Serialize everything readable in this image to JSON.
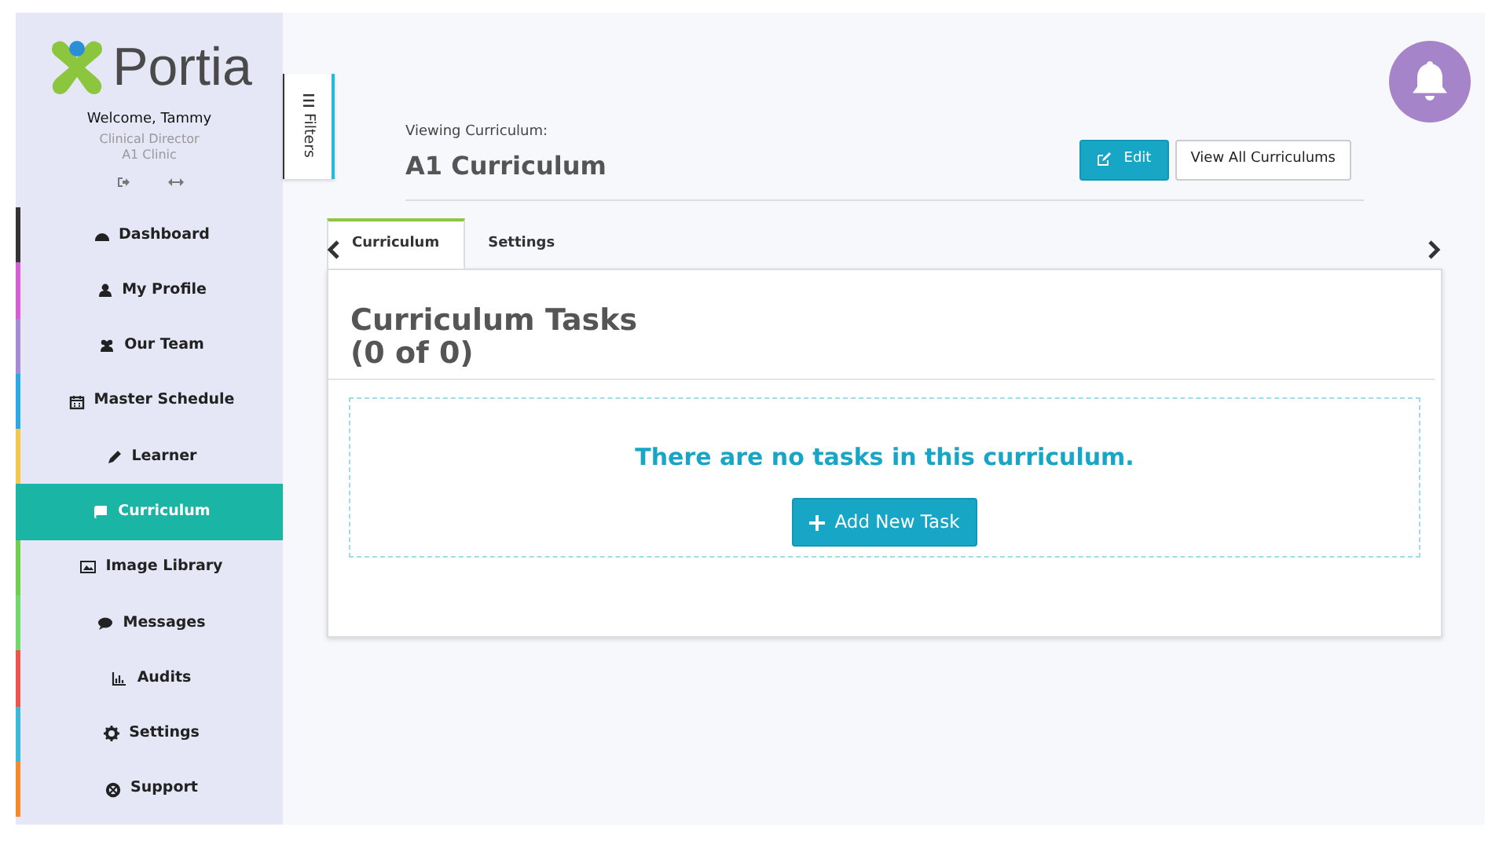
{
  "sidebar": {
    "logo": "Portia",
    "welcome": "Welcome, Tammy",
    "role": "Clinical Director",
    "clinic": "A1 Clinic",
    "items": [
      {
        "label": "Dashboard",
        "color": "#333333",
        "selected": false
      },
      {
        "label": "My Profile",
        "color": "#d65fd6",
        "selected": false
      },
      {
        "label": "Our Team",
        "color": "#a58bd6",
        "selected": false
      },
      {
        "label": "Master Schedule",
        "color": "#2ea8e0",
        "selected": false
      },
      {
        "label": "Learner",
        "color": "#f4c84a",
        "selected": false
      },
      {
        "label": "Curriculum",
        "color": "#1bb5a5",
        "selected": true
      },
      {
        "label": "Image Library",
        "color": "#6fcf4f",
        "selected": false
      },
      {
        "label": "Messages",
        "color": "#72d86c",
        "selected": false
      },
      {
        "label": "Audits",
        "color": "#e8564c",
        "selected": false
      },
      {
        "label": "Settings",
        "color": "#3cb8da",
        "selected": false
      },
      {
        "label": "Support",
        "color": "#f58a2c",
        "selected": false
      }
    ]
  },
  "filters": {
    "label": "Filters"
  },
  "header": {
    "caption": "Viewing Curriculum:",
    "title": "A1 Curriculum",
    "buttons": [
      {
        "label": "Edit",
        "kind": "primary"
      },
      {
        "label": "View All Curriculums",
        "kind": "secondary"
      }
    ]
  },
  "tabs": [
    {
      "label": "Curriculum",
      "selected": true
    },
    {
      "label": "Settings",
      "selected": false
    }
  ],
  "card": {
    "title": "Curriculum Tasks",
    "count": "(0 of 0)",
    "empty_message": "There are no tasks in this curriculum.",
    "add_button": "Add New Task"
  }
}
